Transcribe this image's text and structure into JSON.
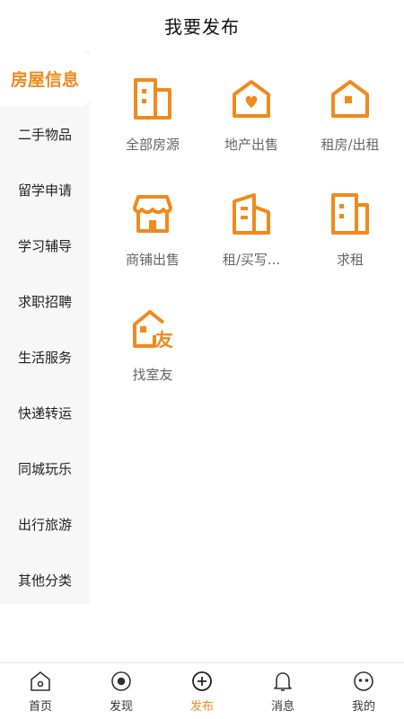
{
  "header": {
    "title": "我要发布"
  },
  "colors": {
    "accent": "#f08a1c",
    "sidebar_bg": "#f7f7f7"
  },
  "sidebar": {
    "items": [
      {
        "label": "房屋信息",
        "active": true
      },
      {
        "label": "二手物品"
      },
      {
        "label": "留学申请"
      },
      {
        "label": "学习辅导"
      },
      {
        "label": "求职招聘"
      },
      {
        "label": "生活服务"
      },
      {
        "label": "快递转运"
      },
      {
        "label": "同城玩乐"
      },
      {
        "label": "出行旅游"
      },
      {
        "label": "其他分类"
      }
    ]
  },
  "categories": [
    {
      "label": "全部房源",
      "icon": "building-icon"
    },
    {
      "label": "地产出售",
      "icon": "house-heart-icon"
    },
    {
      "label": "租房/出租",
      "icon": "house-icon"
    },
    {
      "label": "商铺出售",
      "icon": "shop-icon"
    },
    {
      "label": "租/买写...",
      "icon": "office-building-icon"
    },
    {
      "label": "求租",
      "icon": "building-icon"
    },
    {
      "label": "找室友",
      "icon": "roommate-icon",
      "icon_text": "友"
    }
  ],
  "tabbar": {
    "items": [
      {
        "label": "首页",
        "icon": "home-icon"
      },
      {
        "label": "发现",
        "icon": "discover-icon"
      },
      {
        "label": "发布",
        "icon": "publish-icon",
        "active": true
      },
      {
        "label": "消息",
        "icon": "bell-icon"
      },
      {
        "label": "我的",
        "icon": "profile-icon"
      }
    ]
  }
}
